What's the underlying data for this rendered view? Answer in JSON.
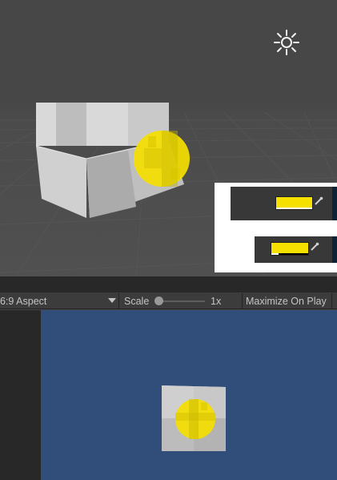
{
  "scene": {
    "light_icon": "sun-icon",
    "objects": [
      "cube",
      "sphere"
    ],
    "sphere_color": "#f5e000",
    "inset": {
      "color_fields": [
        {
          "color": "#f5e000",
          "alpha": 1.0,
          "picker_icon": "eyedropper-icon"
        },
        {
          "color": "#f5e000",
          "alpha": 0.2,
          "picker_icon": "eyedropper-icon"
        }
      ]
    }
  },
  "toolbar": {
    "aspect_label": "6:9 Aspect",
    "scale_label": "Scale",
    "scale_value": "1x",
    "maximize_label": "Maximize On Play"
  },
  "game_view": {
    "background_color": "#314d79"
  }
}
